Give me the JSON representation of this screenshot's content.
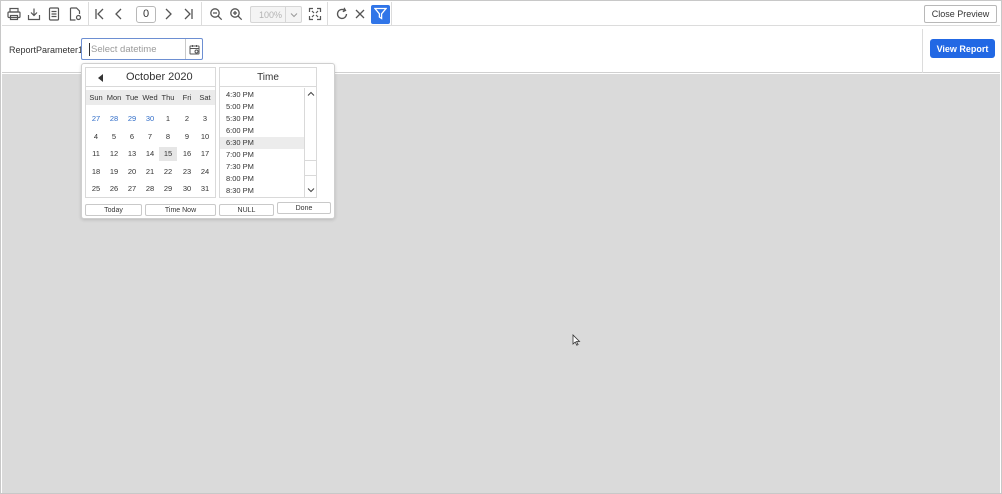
{
  "toolbar": {
    "page_number": "0",
    "zoom_value": "100%",
    "close_preview_label": "Close Preview",
    "accent_color": "#3075e8"
  },
  "parameters": {
    "label": "ReportParameter1",
    "placeholder": "Select datetime",
    "view_report_label": "View Report"
  },
  "calendar": {
    "month_title": "October 2020",
    "weekdays": [
      "Sun",
      "Mon",
      "Tue",
      "Wed",
      "Thu",
      "Fri",
      "Sat"
    ],
    "weeks": [
      [
        "27",
        "28",
        "29",
        "30",
        "1",
        "2",
        "3"
      ],
      [
        "4",
        "5",
        "6",
        "7",
        "8",
        "9",
        "10"
      ],
      [
        "11",
        "12",
        "13",
        "14",
        "15",
        "16",
        "17"
      ],
      [
        "18",
        "19",
        "20",
        "21",
        "22",
        "23",
        "24"
      ],
      [
        "25",
        "26",
        "27",
        "28",
        "29",
        "30",
        "31"
      ]
    ],
    "today": "15"
  },
  "time": {
    "header": "Time",
    "items": [
      "4:30 PM",
      "5:00 PM",
      "5:30 PM",
      "6:00 PM",
      "6:30 PM",
      "7:00 PM",
      "7:30 PM",
      "8:00 PM",
      "8:30 PM"
    ],
    "selected": "6:30 PM"
  },
  "popup_buttons": {
    "today": "Today",
    "time_now": "Time Now",
    "null": "NULL",
    "done": "Done"
  }
}
